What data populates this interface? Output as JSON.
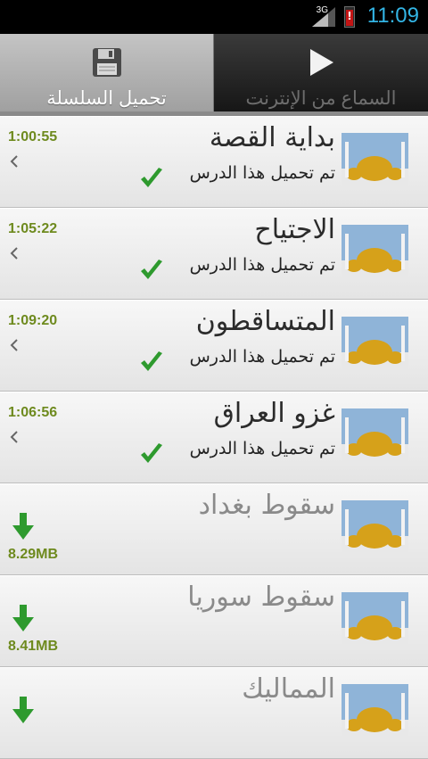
{
  "status_bar": {
    "network": "3G",
    "time": "11:09",
    "battery_color": "#c31414",
    "time_color": "#33b5e5"
  },
  "tabs": [
    {
      "label": "تحميل السلسلة",
      "icon": "floppy-disk-icon",
      "active": true
    },
    {
      "label": "السماع من الإنترنت",
      "icon": "play-icon",
      "active": false
    }
  ],
  "items": [
    {
      "title": "بداية القصة",
      "status": "تم تحميل هذا الدرس",
      "duration": "1:00:55",
      "downloaded": true
    },
    {
      "title": "الاجتياح",
      "status": "تم تحميل هذا الدرس",
      "duration": "1:05:22",
      "downloaded": true
    },
    {
      "title": "المتساقطون",
      "status": "تم تحميل هذا الدرس",
      "duration": "1:09:20",
      "downloaded": true
    },
    {
      "title": "غزو العراق",
      "status": "تم تحميل هذا الدرس",
      "duration": "1:06:56",
      "downloaded": true
    },
    {
      "title": "سقوط بغداد",
      "size": "8.29MB",
      "downloaded": false
    },
    {
      "title": "سقوط سوريا",
      "size": "8.41MB",
      "downloaded": false
    },
    {
      "title": "المماليك",
      "downloaded": false
    }
  ],
  "colors": {
    "accent_green": "#2e9a2e",
    "duration_text": "#6e8a1e"
  }
}
